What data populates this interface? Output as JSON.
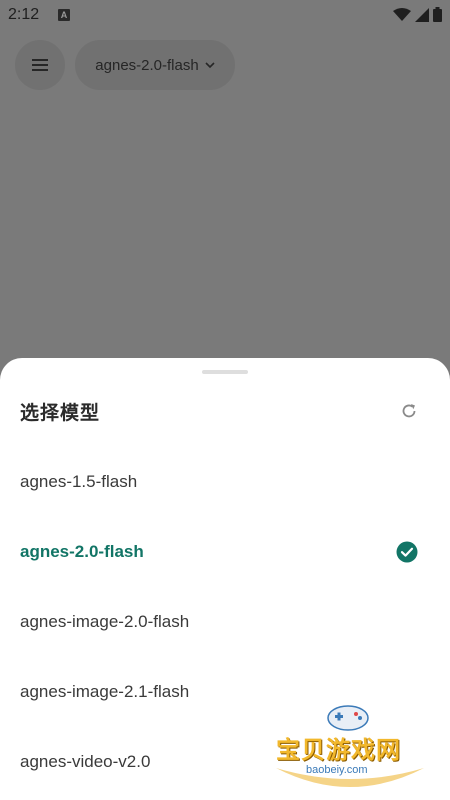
{
  "status_bar": {
    "time": "2:12",
    "notification_icon": "a-notification-icon",
    "icons": [
      "wifi-icon",
      "signal-icon",
      "battery-icon"
    ]
  },
  "top_bar": {
    "menu_icon": "menu-icon",
    "current_model": "agnes-2.0-flash",
    "dropdown_icon": "chevron-down-icon"
  },
  "sheet": {
    "title": "选择模型",
    "refresh_icon": "refresh-icon",
    "models": [
      {
        "label": "agnes-1.5-flash",
        "selected": false
      },
      {
        "label": "agnes-2.0-flash",
        "selected": true
      },
      {
        "label": "agnes-image-2.0-flash",
        "selected": false
      },
      {
        "label": "agnes-image-2.1-flash",
        "selected": false
      },
      {
        "label": "agnes-video-v2.0",
        "selected": false
      }
    ],
    "selected_icon": "check-circle-icon"
  },
  "watermark": {
    "text": "宝贝游戏网",
    "sub": "baobeiy.com"
  },
  "colors": {
    "scrim": "#7a7a7a",
    "accent": "#127566",
    "sheet_bg": "#ffffff"
  }
}
